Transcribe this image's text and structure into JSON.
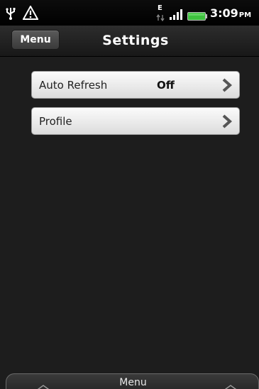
{
  "status_bar": {
    "network_type": "E",
    "time": "3:09",
    "ampm": "PM",
    "icons": [
      "usb-icon",
      "warning-icon",
      "edge-data-icon",
      "signal-icon",
      "battery-icon"
    ]
  },
  "title_bar": {
    "menu_label": "Menu",
    "title": "Settings"
  },
  "settings": {
    "items": [
      {
        "label": "Auto Refresh",
        "value": "Off",
        "icon": "chevron-right-icon"
      },
      {
        "label": "Profile",
        "value": "",
        "icon": "chevron-right-icon"
      }
    ]
  },
  "bottom_bar": {
    "label": "Menu"
  },
  "colors": {
    "background": "#1d1d1d",
    "row_background": "#f2f2f2",
    "battery_green": "#3ec23e"
  }
}
